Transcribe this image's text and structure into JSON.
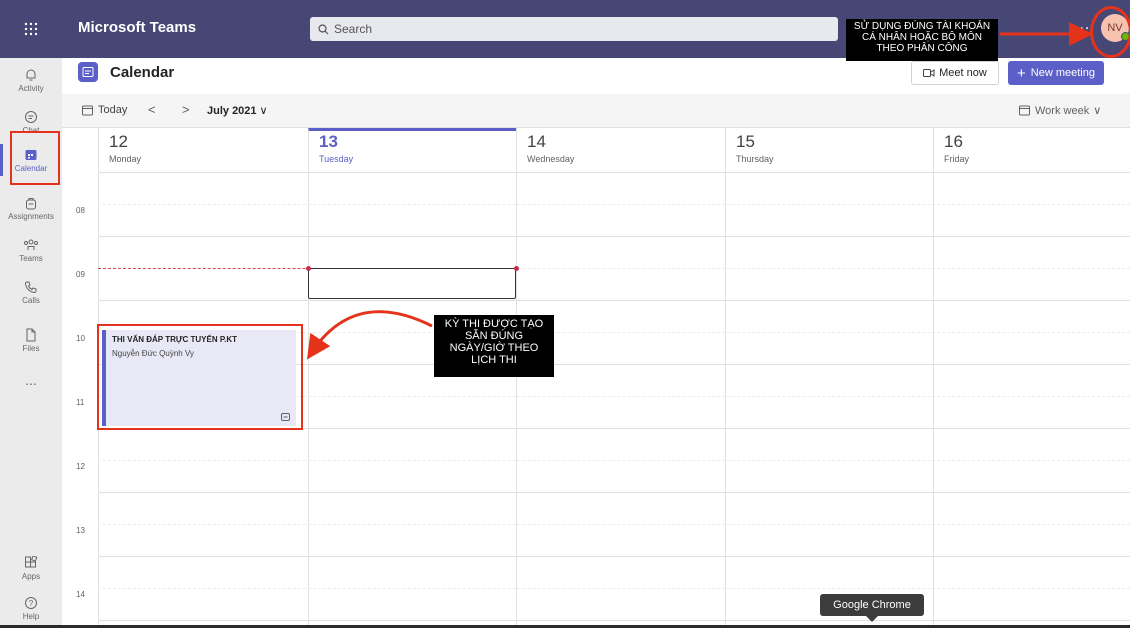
{
  "topbar": {
    "app_title": "Microsoft Teams",
    "search_placeholder": "Search",
    "more": "...",
    "avatar_initials": "NV"
  },
  "rail": {
    "items": [
      {
        "label": "Activity",
        "icon": "bell-icon"
      },
      {
        "label": "Chat",
        "icon": "chat-icon"
      },
      {
        "label": "Calendar",
        "icon": "calendar-icon",
        "active": true
      },
      {
        "label": "Assignments",
        "icon": "backpack-icon"
      },
      {
        "label": "Teams",
        "icon": "teams-icon"
      },
      {
        "label": "Calls",
        "icon": "phone-icon"
      },
      {
        "label": "Files",
        "icon": "file-icon"
      },
      {
        "label": "...",
        "icon": "more-icon"
      },
      {
        "label": "Apps",
        "icon": "apps-icon"
      },
      {
        "label": "Help",
        "icon": "help-icon"
      }
    ]
  },
  "header": {
    "title": "Calendar",
    "meet_now": "Meet now",
    "new_meeting": "New meeting"
  },
  "toolbar": {
    "today": "Today",
    "prev": "<",
    "next": ">",
    "month": "July 2021",
    "view": "Work week"
  },
  "days": [
    {
      "num": "12",
      "name": "Monday"
    },
    {
      "num": "13",
      "name": "Tuesday",
      "today": true
    },
    {
      "num": "14",
      "name": "Wednesday"
    },
    {
      "num": "15",
      "name": "Thursday"
    },
    {
      "num": "16",
      "name": "Friday"
    }
  ],
  "hours": [
    "08",
    "09",
    "10",
    "11",
    "12",
    "13",
    "14"
  ],
  "event": {
    "title": "THI VẤN ĐÁP TRỰC TUYẾN P.KT",
    "organizer": "Nguyễn Đức Quỳnh Vy"
  },
  "annotations": {
    "account_note": "SỬ DỤNG ĐÚNG TÀI KHOẢN CÁ NHÂN HOẶC BỘ MÔN THEO PHÂN CÔNG",
    "exam_note": "KỲ THI ĐƯỢC TẠO SẴN ĐÚNG NGÀY/GIỜ THEO LỊCH THI"
  },
  "tooltip": "Google Chrome",
  "colors": {
    "topbar": "#464775",
    "accent": "#5b5fc7",
    "annotation_red": "#e5321a"
  }
}
